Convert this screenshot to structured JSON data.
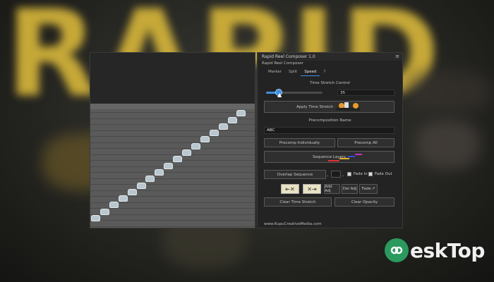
{
  "background": {
    "word": "RAPID"
  },
  "panel": {
    "title": "Rapid Reel Composer 1.0",
    "menu_icon": "≡",
    "subtitle": "Rapid Reel Composer",
    "tabs": [
      "Marker",
      "Split",
      "Speed",
      "?"
    ],
    "active_tab": "Speed",
    "time_stretch": {
      "label": "Time Stretch Control",
      "value": "35",
      "apply_label": "Apply Time Stretch"
    },
    "precomp": {
      "label": "Precomposition Name",
      "value": "ABC",
      "individually_label": "Precomp Individually",
      "all_label": "Precomp All",
      "sequence_label": "Sequence Layers"
    },
    "overlap": {
      "label": "Overlap Sequence",
      "fade_in": "Fade In",
      "fade_out": "Fade Out",
      "dash": "-"
    },
    "adjust": {
      "add_label": "Add Adj",
      "del_label": "Del Adj",
      "fade_label": "Fade"
    },
    "clear_time_stretch": "Clear Time Stretch",
    "clear_opacity": "Clear Opacity",
    "footer": "www.KupuCreativeMedia.com"
  },
  "watermark": {
    "text": "eskTop"
  },
  "colors": {
    "accent": "#3f8fe0",
    "brand_green": "#2a9a5e",
    "bg_gold": "#d4b43a"
  }
}
